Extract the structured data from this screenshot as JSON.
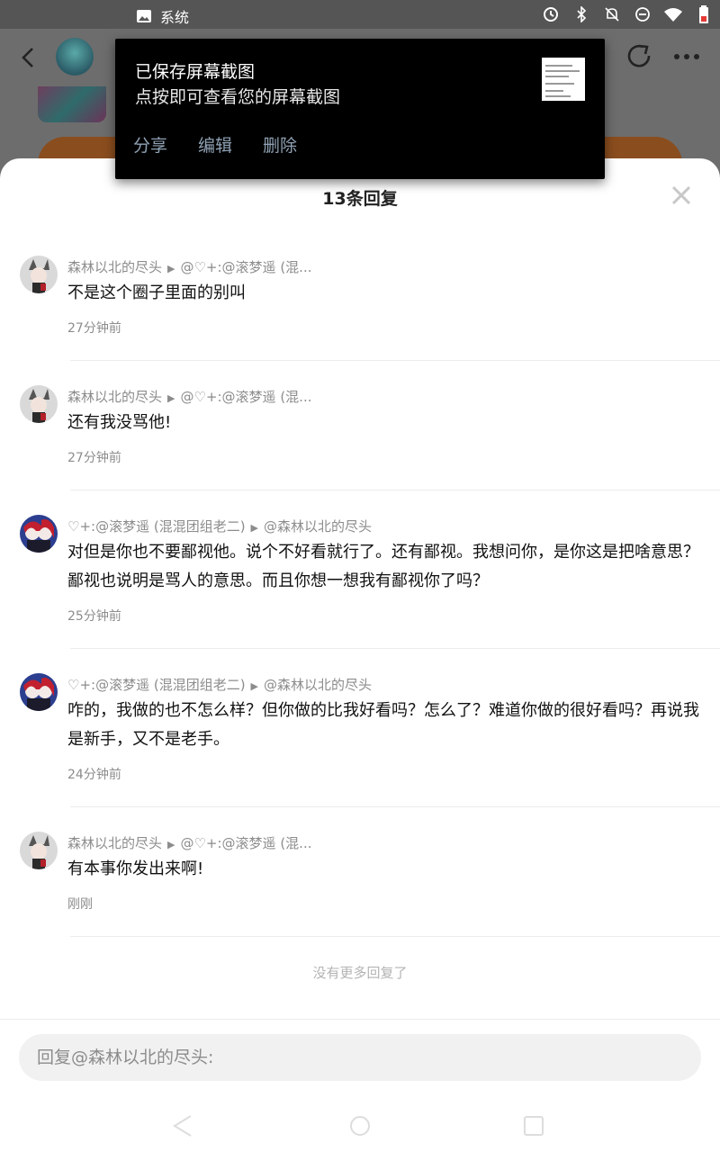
{
  "status_bar": {
    "notification_label": "系统",
    "icons": [
      "image-icon",
      "sync-icon",
      "bluetooth-icon",
      "notifications-off-icon",
      "do-not-disturb-icon",
      "wifi-icon",
      "battery-icon"
    ]
  },
  "toast": {
    "title": "已保存屏幕截图",
    "subtitle": "点按即可查看您的屏幕截图",
    "actions": [
      "分享",
      "编辑",
      "删除"
    ]
  },
  "sheet": {
    "title": "13条回复",
    "replies": [
      {
        "author": "森林以北的尽头",
        "target": "@♡+:@滚梦遥 (混...",
        "text": "不是这个圈子里面的别叫",
        "time": "27分钟前"
      },
      {
        "author": "森林以北的尽头",
        "target": "@♡+:@滚梦遥 (混...",
        "text": "还有我没骂他!",
        "time": "27分钟前"
      },
      {
        "author": "♡+:@滚梦遥 (混混团组老二)",
        "target": "@森林以北的尽头",
        "text": "对但是你也不要鄙视他。说个不好看就行了。还有鄙视。我想问你，是你这是把啥意思？鄙视也说明是骂人的意思。而且你想一想我有鄙视你了吗？",
        "time": "25分钟前"
      },
      {
        "author": "♡+:@滚梦遥 (混混团组老二)",
        "target": "@森林以北的尽头",
        "text": "咋的，我做的也不怎么样？但你做的比我好看吗？怎么了？难道你做的很好看吗？再说我是新手，又不是老手。",
        "time": "24分钟前"
      },
      {
        "author": "森林以北的尽头",
        "target": "@♡+:@滚梦遥 (混...",
        "text": "有本事你发出来啊!",
        "time": "刚刚"
      }
    ],
    "no_more": "没有更多回复了",
    "input_placeholder": "回复@森林以北的尽头:"
  }
}
